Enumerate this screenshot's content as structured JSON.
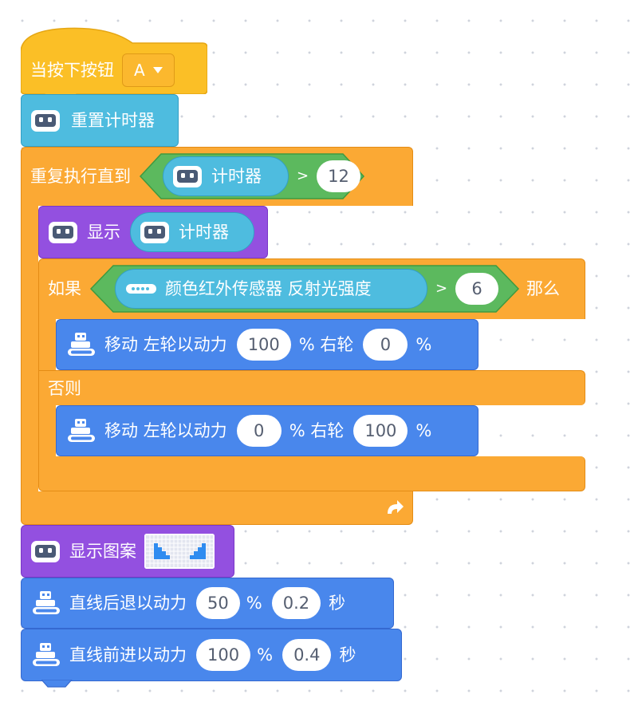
{
  "palette": {
    "event": "#fbbf26",
    "event_edge": "#e5a613",
    "control": "#fba934",
    "control_edge": "#e48c15",
    "sensing": "#4ebcdf",
    "sensing_edge": "#339fc4",
    "looks": "#9350e0",
    "looks_edge": "#7a37c7",
    "motion": "#4987ec",
    "motion_edge": "#3569d0",
    "operator": "#5cb95e",
    "operator_edge": "#3e9a40"
  },
  "hat": {
    "label": "当按下按钮",
    "button_value": "A",
    "dropdown_icon": "triangle-down-icon"
  },
  "reset_timer": {
    "icon": "robot-face-icon",
    "label": "重置计时器"
  },
  "repeat_until": {
    "label": "重复执行直到",
    "condition": {
      "reporter_icon": "robot-face-icon",
      "reporter_label": "计时器",
      "operator": ">",
      "value": "12"
    },
    "loop_icon": "loop-arrow-icon"
  },
  "show_timer": {
    "icon": "robot-face-icon",
    "label": "显示",
    "reporter_icon": "robot-face-icon",
    "reporter_label": "计时器"
  },
  "if_else": {
    "if_label": "如果",
    "condition": {
      "sensor_icon": "ir-sensor-icon",
      "sensor_label": "颜色红外传感器 反射光强度",
      "operator": ">",
      "value": "6"
    },
    "then_label": "那么",
    "else_label": "否则",
    "move_then": {
      "icon": "robot-car-icon",
      "label1": "移动 左轮以动力",
      "left": "100",
      "label2": "% 右轮",
      "right": "0",
      "label3": "%"
    },
    "move_else": {
      "icon": "robot-car-icon",
      "label1": "移动 左轮以动力",
      "left": "0",
      "label2": "% 右轮",
      "right": "100",
      "label3": "%"
    }
  },
  "show_pattern": {
    "icon": "robot-face-icon",
    "label": "显示图案",
    "pattern_icon": "led-matrix-icon"
  },
  "backward": {
    "icon": "robot-car-icon",
    "label": "直线后退以动力",
    "power": "50",
    "pct": "%",
    "time": "0.2",
    "unit": "秒"
  },
  "forward": {
    "icon": "robot-car-icon",
    "label": "直线前进以动力",
    "power": "100",
    "pct": "%",
    "time": "0.4",
    "unit": "秒"
  }
}
